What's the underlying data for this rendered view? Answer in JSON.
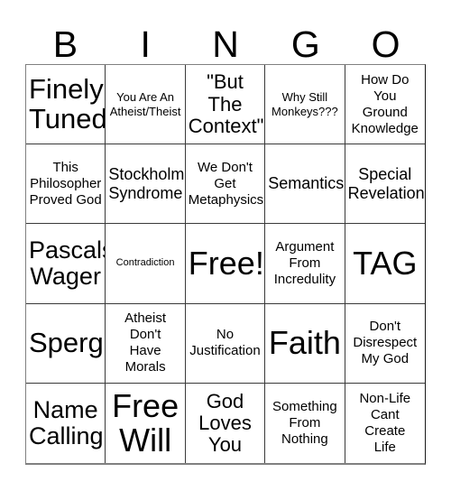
{
  "header": {
    "letters": [
      "B",
      "I",
      "N",
      "G",
      "O"
    ]
  },
  "grid": {
    "columns": 5,
    "rows": 5,
    "cells": [
      {
        "text": "Finely\nTuned",
        "size": "h1"
      },
      {
        "text": "You Are An\nAtheist/Theist",
        "size": "s"
      },
      {
        "text": "\"But The\nContext\"",
        "size": "xl"
      },
      {
        "text": "Why Still\nMonkeys???",
        "size": "s"
      },
      {
        "text": "How Do\nYou\nGround\nKnowledge",
        "size": "m"
      },
      {
        "text": "This\nPhilosopher\nProved God",
        "size": "m"
      },
      {
        "text": "Stockholm\nSyndrome",
        "size": "l"
      },
      {
        "text": "We Don't\nGet\nMetaphysics",
        "size": "m"
      },
      {
        "text": "Semantics",
        "size": "l"
      },
      {
        "text": "Special\nRevelation",
        "size": "l"
      },
      {
        "text": "Pascals\nWager",
        "size": "xxl"
      },
      {
        "text": "Contradiction",
        "size": "xs"
      },
      {
        "text": "Free!",
        "size": "h2"
      },
      {
        "text": "Argument\nFrom\nIncredulity",
        "size": "m"
      },
      {
        "text": "TAG",
        "size": "h2"
      },
      {
        "text": "Sperg",
        "size": "h1"
      },
      {
        "text": "Atheist\nDon't\nHave\nMorals",
        "size": "m"
      },
      {
        "text": "No\nJustification",
        "size": "m"
      },
      {
        "text": "Faith",
        "size": "h2"
      },
      {
        "text": "Don't\nDisrespect\nMy God",
        "size": "m"
      },
      {
        "text": "Name\nCalling",
        "size": "xxl"
      },
      {
        "text": "Free\nWill",
        "size": "h2"
      },
      {
        "text": "God\nLoves\nYou",
        "size": "xl"
      },
      {
        "text": "Something\nFrom\nNothing",
        "size": "m"
      },
      {
        "text": "Non-Life\nCant\nCreate\nLife",
        "size": "m"
      }
    ]
  },
  "colors": {
    "background": "#ffffff",
    "text": "#000000",
    "cell_border": "#3a3a3a",
    "outer_border": "#808080"
  }
}
